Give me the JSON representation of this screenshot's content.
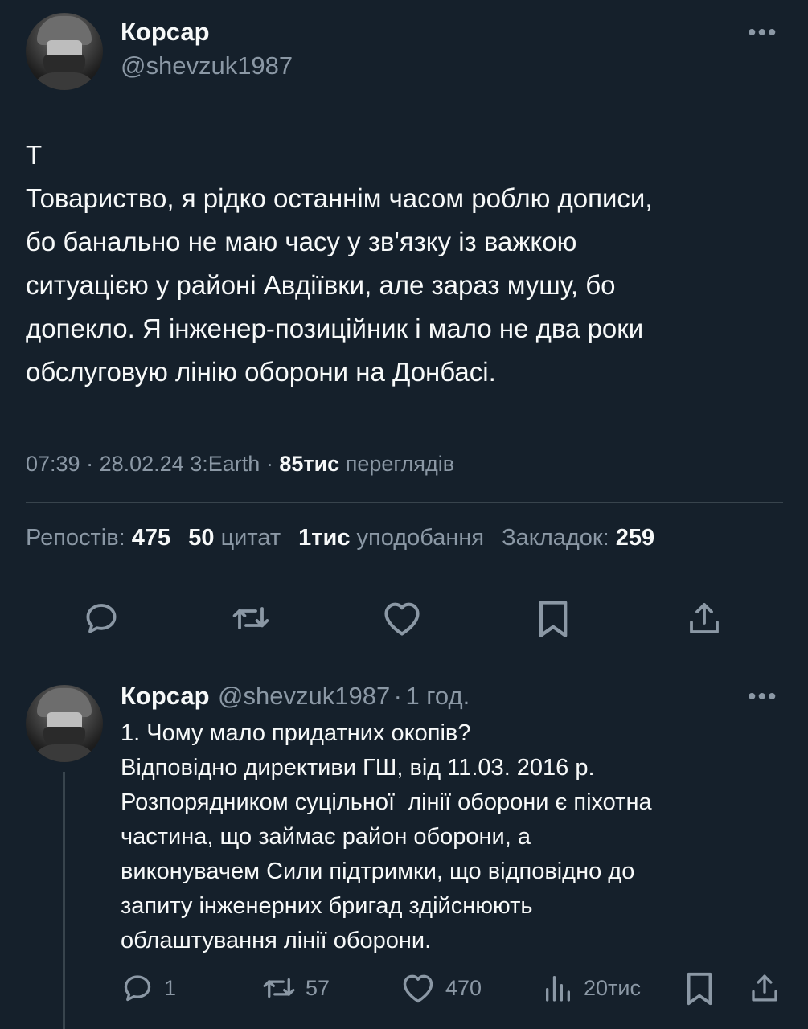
{
  "main_tweet": {
    "author_name": "Корсар",
    "author_handle": "@shevzuk1987",
    "more_label": "•••",
    "text_lines": [
      "Т",
      "Товариство, я рідко останнім часом роблю дописи,",
      "бо банально не маю часу у зв'язку із важкою",
      "ситуацією у районі Авдіївки, але зараз мушу, бо",
      "допекло. Я інженер-позиційник і мало не два роки",
      "обслуговую лінію оборони на Донбасі."
    ],
    "time": "07:39",
    "date": "28.02.24",
    "client": "3:Earth",
    "views_count": "85тис",
    "views_label": "переглядів",
    "separator": "·",
    "stats": {
      "reposts_label": "Репостів:",
      "reposts_count": "475",
      "quotes_count": "50",
      "quotes_label": "цитат",
      "likes_count": "1тис",
      "likes_label": "уподобання",
      "bookmarks_label": "Закладок:",
      "bookmarks_count": "259"
    },
    "actions": [
      "reply-icon",
      "retweet-icon",
      "heart-icon",
      "bookmark-icon",
      "share-icon"
    ]
  },
  "reply_tweet": {
    "author_name": "Корсар",
    "author_handle": "@shevzuk1987",
    "separator": "·",
    "time_ago": "1 год.",
    "more_label": "•••",
    "text_lines": [
      "1. Чому мало придатних окопів?",
      "Відповідно директиви ГШ, від 11.03. 2016 р.",
      "Розпорядником суцільної  лінії оборони є піхотна",
      "частина, що займає район оборони, а",
      "виконувачем Сили підтримки, що відповідно до",
      "запиту інженерних бригад здійснюють",
      "облаштування лінії оборони."
    ],
    "actions": {
      "replies": "1",
      "retweets": "57",
      "likes": "470",
      "views": "20тис"
    }
  },
  "colors": {
    "background": "#15202b",
    "text": "#f7f9f9",
    "secondary": "#8b98a5",
    "divider": "#38444d"
  }
}
